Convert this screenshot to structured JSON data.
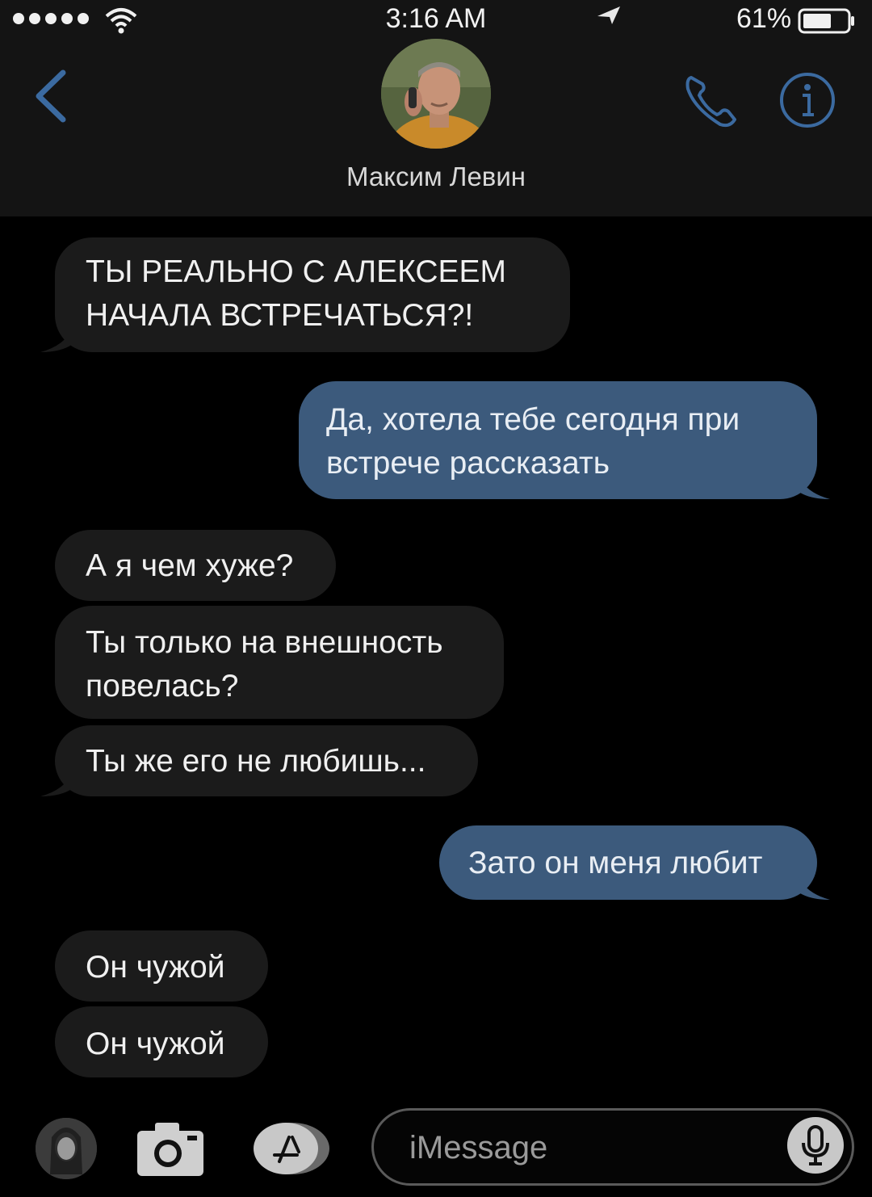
{
  "status_bar": {
    "time": "3:16 AM",
    "battery": "61%",
    "icons": [
      "signal-dots",
      "wifi-icon",
      "location-icon",
      "battery-icon"
    ]
  },
  "header": {
    "contact_name": "Максим Левин",
    "icons": [
      "chevron-left-icon",
      "phone-icon",
      "info-icon"
    ]
  },
  "messages": [
    {
      "direction": "incoming",
      "text": "ТЫ РЕАЛЬНО С АЛЕКСЕЕМ НАЧАЛА ВСТРЕЧАТЬСЯ?!"
    },
    {
      "direction": "outgoing",
      "text": "Да, хотела тебе сегодня при встрече рассказать"
    },
    {
      "direction": "incoming",
      "text": "А я чем хуже?"
    },
    {
      "direction": "incoming",
      "text": "Ты только на внешность повелась?"
    },
    {
      "direction": "incoming",
      "text": "Ты же его не любишь..."
    },
    {
      "direction": "outgoing",
      "text": "Зато он меня любит"
    },
    {
      "direction": "incoming",
      "text": "Он чужой"
    },
    {
      "direction": "incoming",
      "text": "Он чужой"
    }
  ],
  "input": {
    "placeholder": "iMessage",
    "icons": [
      "memoji-icon",
      "camera-icon",
      "appstore-icon",
      "microphone-icon"
    ]
  },
  "colors": {
    "header_bg": "#141414",
    "incoming_bubble": "#1b1b1b",
    "outgoing_bubble": "#3c5a7c",
    "accent": "#3b6aa0"
  }
}
